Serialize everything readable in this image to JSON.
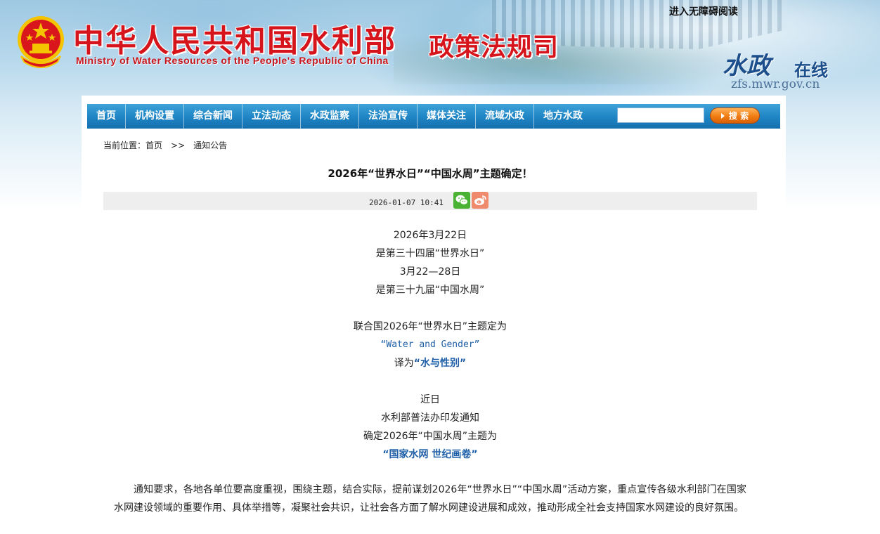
{
  "header": {
    "site_title": "中华人民共和国水利部",
    "site_subtitle": "Ministry of Water Resources of the People's Republic of China",
    "dept_title": "政策法规司",
    "accessible_link": "进入无障碍阅读",
    "logo_text_1": "水政",
    "logo_text_2": "在线",
    "domain": "zfs.mwr.gov.cn"
  },
  "nav": {
    "items": [
      "首页",
      "机构设置",
      "综合新闻",
      "立法动态",
      "水政监察",
      "法治宣传",
      "媒体关注",
      "流域水政",
      "地方水政"
    ],
    "search_placeholder": "",
    "search_label": "搜 索"
  },
  "breadcrumb": {
    "prefix": "当前位置：",
    "home": "首页",
    "separator": ">>",
    "current": "通知公告"
  },
  "article": {
    "title": "2026年“世界水日”“中国水周”主题确定！",
    "date": "2026-01-07 10:41",
    "share": [
      "wechat-icon",
      "weibo-icon"
    ],
    "lines": [
      "2026年3月22日",
      "是第三十四届“世界水日”",
      "3月22—28日",
      "是第三十九届“中国水周”",
      "",
      "联合国2026年“世界水日”主题定为",
      "“Water and Gender”",
      "",
      "",
      "近日",
      "水利部普法办印发通知",
      "确定2026年“中国水周”主题为",
      "“国家水网 世纪画卷”"
    ],
    "translate_prefix": "译为",
    "translate_value": "“水与性别”",
    "paragraph": "通知要求，各地各单位要高度重视，围绕主题，结合实际，提前谋划2026年“世界水日”“中国水周”活动方案，重点宣传各级水利部门在国家水网建设领域的重要作用、具体举措等，凝聚社会共识，让社会各方面了解水网建设进展和成效，推动形成全社会支持国家水网建设的良好氛围。"
  },
  "colors": {
    "nav_bg": "#1e84c4",
    "title_red": "#d5141b",
    "link_blue": "#1f5fa8",
    "search_orange": "#f07c12"
  }
}
